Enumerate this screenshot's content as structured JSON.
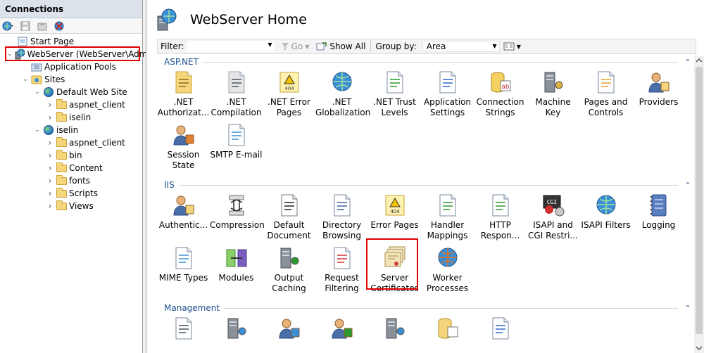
{
  "connections": {
    "title": "Connections",
    "tree": [
      {
        "label": "Start Page",
        "level": 0,
        "icon": "start-page-icon"
      },
      {
        "label": "WebServer (WebServer\\Admi",
        "level": 0,
        "icon": "server-icon"
      },
      {
        "label": "Application Pools",
        "level": 1,
        "icon": "app-pools-icon"
      },
      {
        "label": "Sites",
        "level": 1,
        "icon": "sites-icon"
      },
      {
        "label": "Default Web Site",
        "level": 2,
        "icon": "globe-icon"
      },
      {
        "label": "aspnet_client",
        "level": 3,
        "icon": "folder-icon"
      },
      {
        "label": "iselin",
        "level": 3,
        "icon": "folder-icon"
      },
      {
        "label": "iselin",
        "level": 2,
        "icon": "globe-icon"
      },
      {
        "label": "aspnet_client",
        "level": 3,
        "icon": "folder-icon"
      },
      {
        "label": "bin",
        "level": 3,
        "icon": "folder-icon"
      },
      {
        "label": "Content",
        "level": 3,
        "icon": "folder-icon"
      },
      {
        "label": "fonts",
        "level": 3,
        "icon": "folder-icon"
      },
      {
        "label": "Scripts",
        "level": 3,
        "icon": "folder-icon"
      },
      {
        "label": "Views",
        "level": 3,
        "icon": "folder-icon"
      }
    ]
  },
  "main": {
    "title": "WebServer Home",
    "filter": {
      "label": "Filter:",
      "value": "",
      "go_label": "Go",
      "show_all_label": "Show All",
      "group_by_label": "Group by:",
      "group_by_value": "Area"
    },
    "sections": [
      {
        "name": "ASP.NET",
        "items": [
          {
            "label": ".NET\nAuthorizat...",
            "icon": "net-authorization-icon"
          },
          {
            "label": ".NET\nCompilation",
            "icon": "net-compilation-icon"
          },
          {
            "label": ".NET Error\nPages",
            "icon": "net-error-pages-icon"
          },
          {
            "label": ".NET\nGlobalization",
            "icon": "net-globalization-icon"
          },
          {
            "label": ".NET Trust\nLevels",
            "icon": "net-trust-levels-icon"
          },
          {
            "label": "Application\nSettings",
            "icon": "application-settings-icon"
          },
          {
            "label": "Connection\nStrings",
            "icon": "connection-strings-icon"
          },
          {
            "label": "Machine Key",
            "icon": "machine-key-icon"
          },
          {
            "label": "Pages and\nControls",
            "icon": "pages-controls-icon"
          },
          {
            "label": "Providers",
            "icon": "providers-icon"
          },
          {
            "label": "Session State",
            "icon": "session-state-icon"
          },
          {
            "label": "SMTP E-mail",
            "icon": "smtp-email-icon"
          }
        ]
      },
      {
        "name": "IIS",
        "items": [
          {
            "label": "Authentic...",
            "icon": "authentication-icon"
          },
          {
            "label": "Compression",
            "icon": "compression-icon"
          },
          {
            "label": "Default\nDocument",
            "icon": "default-document-icon"
          },
          {
            "label": "Directory\nBrowsing",
            "icon": "directory-browsing-icon"
          },
          {
            "label": "Error Pages",
            "icon": "error-pages-icon"
          },
          {
            "label": "Handler\nMappings",
            "icon": "handler-mappings-icon"
          },
          {
            "label": "HTTP\nRespon...",
            "icon": "http-response-icon"
          },
          {
            "label": "ISAPI and\nCGI Restri...",
            "icon": "isapi-cgi-icon"
          },
          {
            "label": "ISAPI Filters",
            "icon": "isapi-filters-icon"
          },
          {
            "label": "Logging",
            "icon": "logging-icon"
          },
          {
            "label": "MIME Types",
            "icon": "mime-types-icon"
          },
          {
            "label": "Modules",
            "icon": "modules-icon"
          },
          {
            "label": "Output\nCaching",
            "icon": "output-caching-icon"
          },
          {
            "label": "Request\nFiltering",
            "icon": "request-filtering-icon"
          },
          {
            "label": "Server\nCertificates",
            "icon": "server-certificates-icon"
          },
          {
            "label": "Worker\nProcesses",
            "icon": "worker-processes-icon"
          }
        ]
      },
      {
        "name": "Management",
        "items": [
          {
            "label": "",
            "icon": "configuration-editor-icon"
          },
          {
            "label": "",
            "icon": "feature-delegation-icon"
          },
          {
            "label": "",
            "icon": "iis-manager-permissions-icon"
          },
          {
            "label": "",
            "icon": "iis-manager-users-icon"
          },
          {
            "label": "",
            "icon": "management-service-icon"
          },
          {
            "label": "",
            "icon": "shared-configuration-icon"
          },
          {
            "label": "",
            "icon": "web-platform-icon"
          }
        ]
      }
    ]
  },
  "colors": {
    "section_header": "#1e4e8c",
    "highlight": "#e00000",
    "connections_header_bg": "#dde3ea"
  }
}
